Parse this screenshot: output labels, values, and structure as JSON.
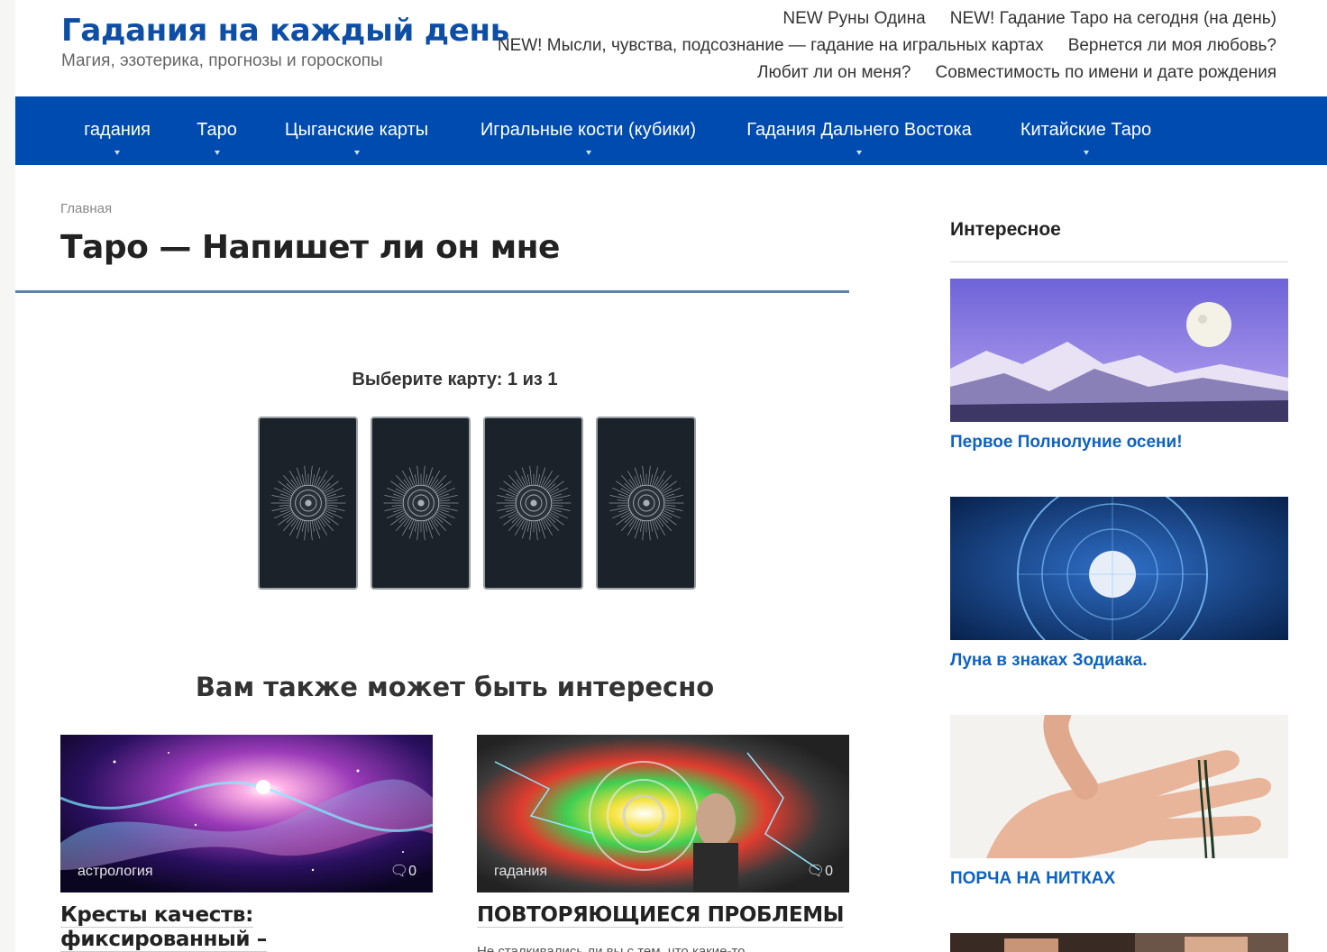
{
  "site": {
    "title": "Гадания на каждый день",
    "tagline": "Магия, эзотерика, прогнозы и гороскопы"
  },
  "top_links": [
    "NEW Руны Одина",
    "NEW! Гадание Таро на сегодня (на день)",
    "NEW! Мысли, чувства, подсознание — гадание на игральных картах",
    "Вернется ли моя любовь?",
    "Любит ли он меня?",
    "Совместимость по имени и дате рождения"
  ],
  "nav": [
    {
      "label": "гадания"
    },
    {
      "label": "Таро"
    },
    {
      "label": "Цыганские карты"
    },
    {
      "label": "Игральные кости (кубики)"
    },
    {
      "label": "Гадания Дальнего Востока"
    },
    {
      "label": "Китайские Таро"
    }
  ],
  "breadcrumb": "Главная",
  "page_title": "Таро — Напишет ли он мне",
  "choose_card": "Выберите карту: 1 из 1",
  "cards_count": 4,
  "related": {
    "heading": "Вам также может быть интересно",
    "items": [
      {
        "category": "астрология",
        "comments": "0",
        "title": "Кресты качеств: фиксированный – устойчивость, стабильность,",
        "excerpt": ""
      },
      {
        "category": "гадания",
        "comments": "0",
        "title": "ПОВТОРЯЮЩИЕСЯ ПРОБЛЕМЫ",
        "excerpt": "Не сталкивались ли вы с тем, что какие-то"
      }
    ]
  },
  "sidebar": {
    "heading": "Интересное",
    "items": [
      {
        "caption": "Первое Полнолуние осени!"
      },
      {
        "caption": "Луна в знаках Зодиака."
      },
      {
        "caption": "ПОРЧА НА НИТКАХ"
      }
    ]
  },
  "colors": {
    "brand": "#0d4ea6",
    "nav_bg": "#004bb0",
    "link": "#0d62c2"
  }
}
